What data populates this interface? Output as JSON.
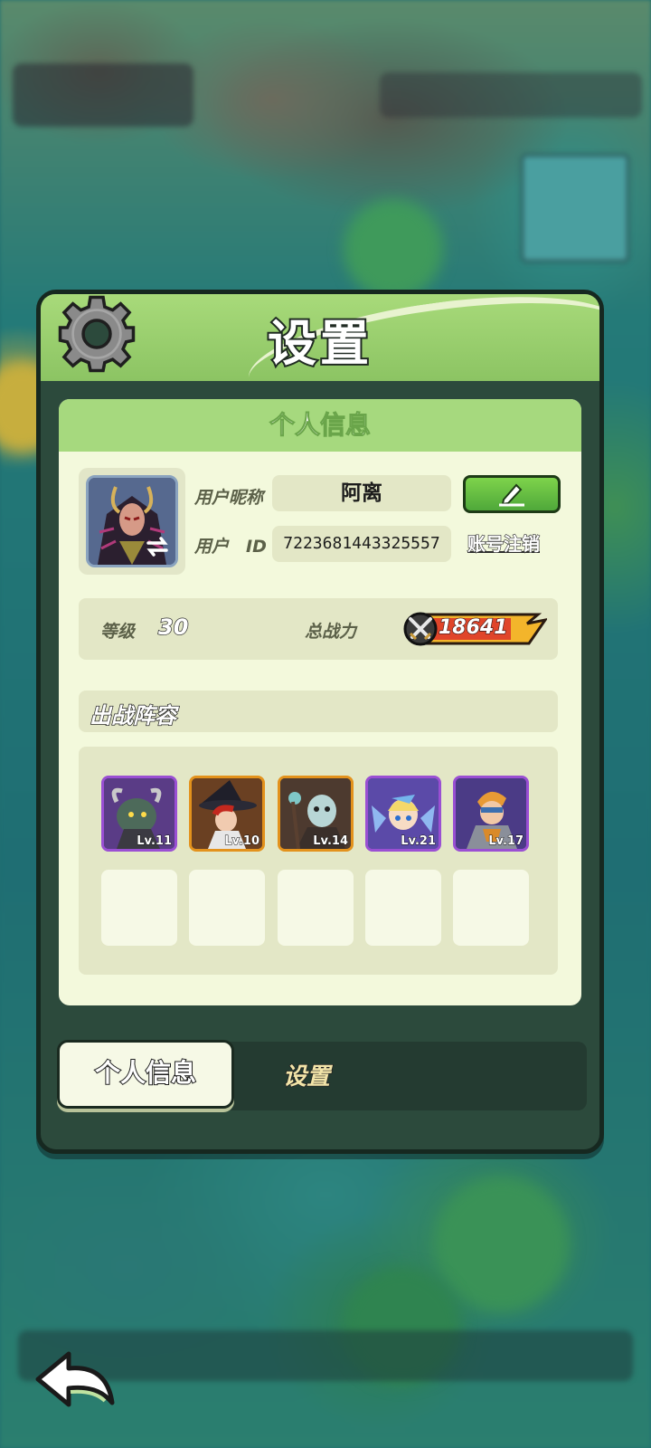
{
  "dialog": {
    "title": "设置"
  },
  "profile": {
    "section_title": "个人信息",
    "nickname_label": "用户昵称",
    "nickname_value": "阿离",
    "id_label": "用户　ID",
    "id_value": "7223681443325557",
    "cancel_account_label": "账号注销"
  },
  "stats": {
    "level_label": "等级",
    "level_value": "30",
    "power_label": "总战力",
    "power_value": "18641"
  },
  "lineup": {
    "title": "出战阵容",
    "heroes": [
      {
        "level": "Lv.11",
        "rarity": "purple"
      },
      {
        "level": "Lv.10",
        "rarity": "orange"
      },
      {
        "level": "Lv.14",
        "rarity": "orange"
      },
      {
        "level": "Lv.21",
        "rarity": "purple"
      },
      {
        "level": "Lv.17",
        "rarity": "purple"
      }
    ],
    "empty_slots": 5
  },
  "tabs": {
    "personal": "个人信息",
    "settings": "设置"
  },
  "icons": {
    "gear": "gear-icon",
    "edit": "pencil-icon",
    "swap": "swap-icon",
    "power": "crossed-swords-icon",
    "back": "back-arrow-icon"
  },
  "colors": {
    "header_green": "#a6d97e",
    "edit_green": "#5cba3f",
    "rarity_purple": "#9a4fd3",
    "rarity_orange": "#e3921c",
    "power_flame": "#f3b52b"
  }
}
